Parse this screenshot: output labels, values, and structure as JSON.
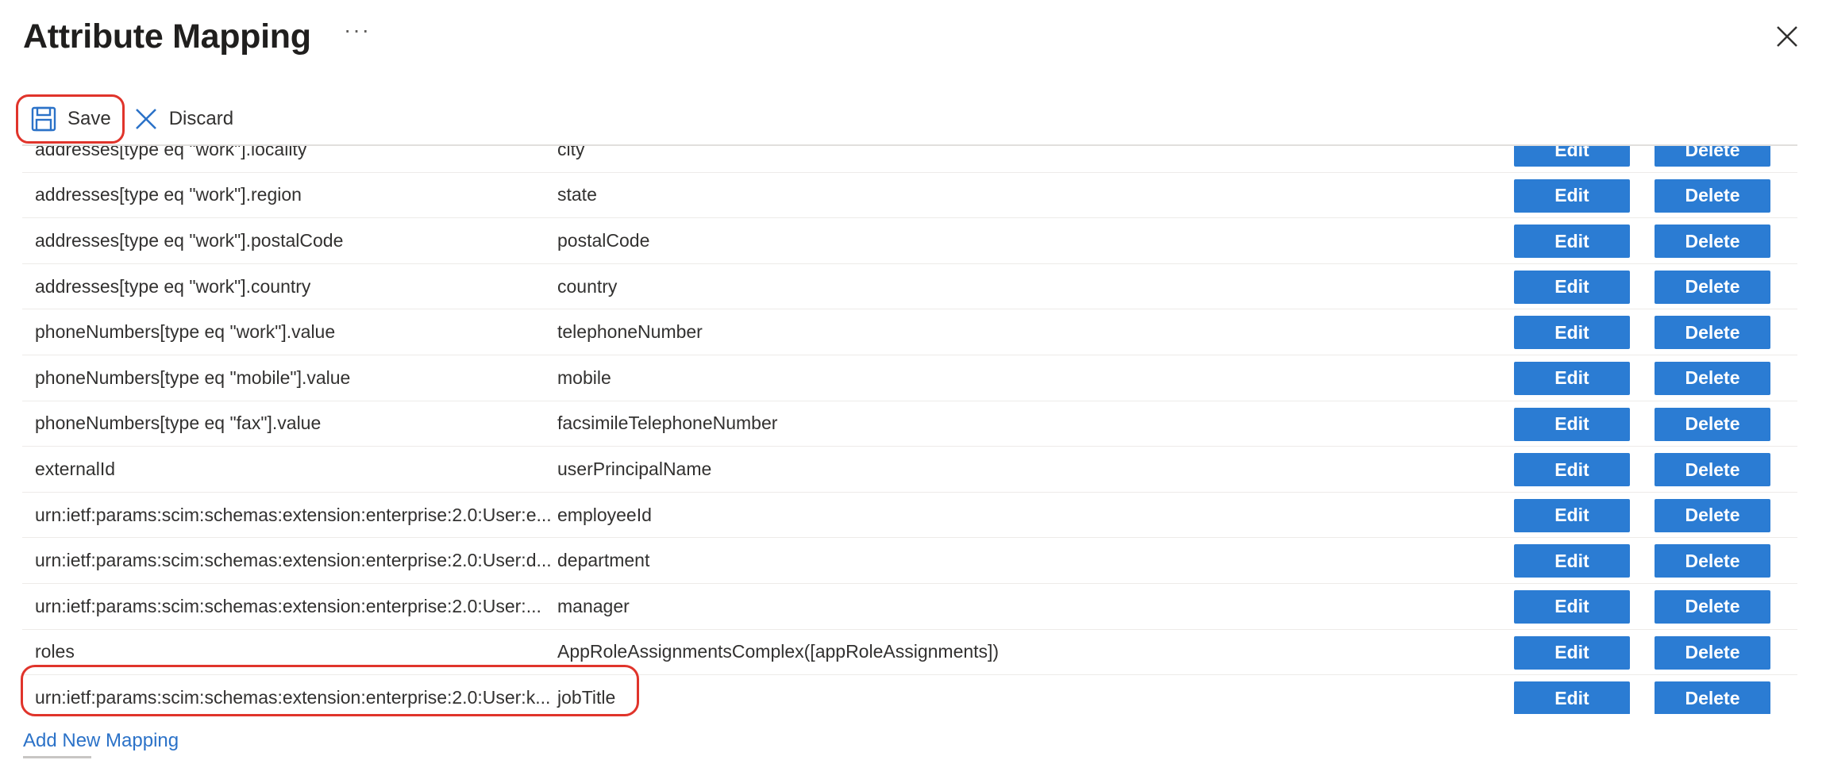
{
  "header": {
    "title": "Attribute Mapping",
    "more_label": "···"
  },
  "icons": {
    "more": "more-icon",
    "close": "close-icon",
    "save": "save-icon",
    "discard": "discard-icon"
  },
  "toolbar": {
    "save_label": "Save",
    "discard_label": "Discard"
  },
  "buttons": {
    "edit_label": "Edit",
    "delete_label": "Delete"
  },
  "mappings": [
    {
      "source": "addresses[type eq \"work\"].locality",
      "target": "city"
    },
    {
      "source": "addresses[type eq \"work\"].region",
      "target": "state"
    },
    {
      "source": "addresses[type eq \"work\"].postalCode",
      "target": "postalCode"
    },
    {
      "source": "addresses[type eq \"work\"].country",
      "target": "country"
    },
    {
      "source": "phoneNumbers[type eq \"work\"].value",
      "target": "telephoneNumber"
    },
    {
      "source": "phoneNumbers[type eq \"mobile\"].value",
      "target": "mobile"
    },
    {
      "source": "phoneNumbers[type eq \"fax\"].value",
      "target": "facsimileTelephoneNumber"
    },
    {
      "source": "externalId",
      "target": "userPrincipalName"
    },
    {
      "source": "urn:ietf:params:scim:schemas:extension:enterprise:2.0:User:e...",
      "target": "employeeId"
    },
    {
      "source": "urn:ietf:params:scim:schemas:extension:enterprise:2.0:User:d...",
      "target": "department"
    },
    {
      "source": "urn:ietf:params:scim:schemas:extension:enterprise:2.0:User:...",
      "target": "manager"
    },
    {
      "source": "roles",
      "target": "AppRoleAssignmentsComplex([appRoleAssignments])"
    },
    {
      "source": "urn:ietf:params:scim:schemas:extension:enterprise:2.0:User:k...",
      "target": "jobTitle"
    }
  ],
  "footer": {
    "add_new_mapping": "Add New Mapping"
  },
  "colors": {
    "accent": "#2b7cd3",
    "link": "#2b72c8",
    "highlight": "#e0342b"
  }
}
